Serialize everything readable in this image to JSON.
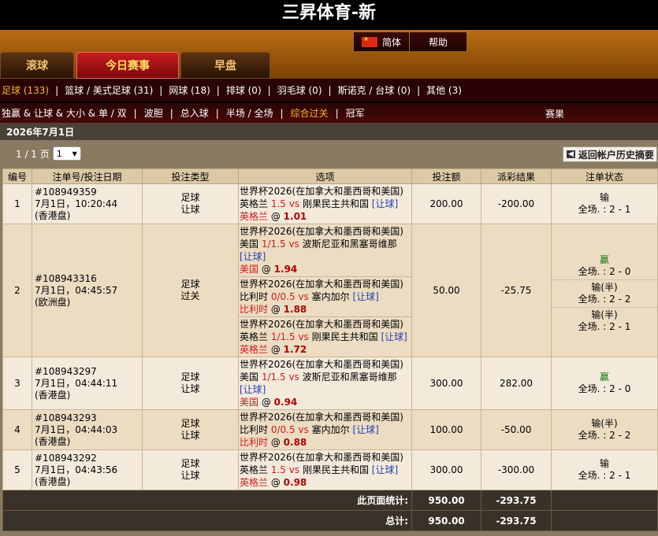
{
  "site": {
    "title": "三昇体育-新"
  },
  "util": {
    "lang": "简体",
    "help": "帮助"
  },
  "tabs": [
    "滚球",
    "今日赛事",
    "早盘"
  ],
  "sports": [
    {
      "label": "足球 (133)"
    },
    {
      "label": "篮球 / 美式足球 (31)"
    },
    {
      "label": "网球 (18)"
    },
    {
      "label": "排球 (0)"
    },
    {
      "label": "羽毛球 (0)"
    },
    {
      "label": "斯诺克 / 台球 (0)"
    },
    {
      "label": "其他 (3)"
    }
  ],
  "bettypes": [
    "独赢 & 让球 & 大小 & 单 / 双",
    "波胆",
    "总入球",
    "半场 / 全场",
    "综合过关",
    "冠军"
  ],
  "result_label": "赛果",
  "date": "2026年7月1日",
  "pager": {
    "text": "1 / 1 页",
    "selected": "1"
  },
  "back_button": "返回帐户历史摘要",
  "columns": [
    "编号",
    "注单号/投注日期",
    "投注类型",
    "选项",
    "投注额",
    "派彩结果",
    "注单状态"
  ],
  "rows": [
    {
      "num": "1",
      "id": "#108949359",
      "date": "7月1日，10:20:44",
      "market": "(香港盘)",
      "type1": "足球",
      "type2": "让球",
      "legs": [
        {
          "league": "世界杯2026(在加拿大和墨西哥和美国)",
          "home": "英格兰",
          "hd": "1.5",
          "vs": "vs",
          "away": "刚果民主共和国",
          "bt": "[让球]",
          "pick": "英格兰",
          "at": "@",
          "odds": "1.01"
        }
      ],
      "amount": "200.00",
      "winloss": "-200.00",
      "status": [
        {
          "res": "输",
          "score": "全场. : 2 - 1",
          "win": false
        }
      ]
    },
    {
      "num": "2",
      "id": "#108943316",
      "date": "7月1日，04:45:57",
      "market": "(欧洲盘)",
      "type1": "足球",
      "type2": "过关",
      "legs": [
        {
          "league": "世界杯2026(在加拿大和墨西哥和美国)",
          "home": "美国",
          "hd": "1/1.5",
          "vs": "vs",
          "away": "波斯尼亚和黑塞哥维那",
          "bt": "[让球]",
          "pick": "美国",
          "at": "@",
          "odds": "1.94"
        },
        {
          "league": "世界杯2026(在加拿大和墨西哥和美国)",
          "home": "比利时",
          "hd": "0/0.5",
          "vs": "vs",
          "away": "塞内加尔",
          "bt": "[让球]",
          "pick": "比利时",
          "at": "@",
          "odds": "1.88"
        },
        {
          "league": "世界杯2026(在加拿大和墨西哥和美国)",
          "home": "英格兰",
          "hd": "1/1.5",
          "vs": "vs",
          "away": "刚果民主共和国",
          "bt": "[让球]",
          "pick": "英格兰",
          "at": "@",
          "odds": "1.72"
        }
      ],
      "amount": "50.00",
      "winloss": "-25.75",
      "status": [
        {
          "res": "赢",
          "score": "全场. : 2 - 0",
          "win": true
        },
        {
          "res": "输(半)",
          "score": "全场. : 2 - 2",
          "win": false
        },
        {
          "res": "输(半)",
          "score": "全场. : 2 - 1",
          "win": false
        }
      ]
    },
    {
      "num": "3",
      "id": "#108943297",
      "date": "7月1日，04:44:11",
      "market": "(香港盘)",
      "type1": "足球",
      "type2": "让球",
      "legs": [
        {
          "league": "世界杯2026(在加拿大和墨西哥和美国)",
          "home": "美国",
          "hd": "1/1.5",
          "vs": "vs",
          "away": "波斯尼亚和黑塞哥维那",
          "bt": "[让球]",
          "pick": "美国",
          "at": "@",
          "odds": "0.94"
        }
      ],
      "amount": "300.00",
      "winloss": "282.00",
      "status": [
        {
          "res": "赢",
          "score": "全场. : 2 - 0",
          "win": true
        }
      ]
    },
    {
      "num": "4",
      "id": "#108943293",
      "date": "7月1日，04:44:03",
      "market": "(香港盘)",
      "type1": "足球",
      "type2": "让球",
      "legs": [
        {
          "league": "世界杯2026(在加拿大和墨西哥和美国)",
          "home": "比利时",
          "hd": "0/0.5",
          "vs": "vs",
          "away": "塞内加尔",
          "bt": "[让球]",
          "pick": "比利时",
          "at": "@",
          "odds": "0.88"
        }
      ],
      "amount": "100.00",
      "winloss": "-50.00",
      "status": [
        {
          "res": "输(半)",
          "score": "全场. : 2 - 2",
          "win": false
        }
      ]
    },
    {
      "num": "5",
      "id": "#108943292",
      "date": "7月1日，04:43:56",
      "market": "(香港盘)",
      "type1": "足球",
      "type2": "让球",
      "legs": [
        {
          "league": "世界杯2026(在加拿大和墨西哥和美国)",
          "home": "英格兰",
          "hd": "1.5",
          "vs": "vs",
          "away": "刚果民主共和国",
          "bt": "[让球]",
          "pick": "英格兰",
          "at": "@",
          "odds": "0.98"
        }
      ],
      "amount": "300.00",
      "winloss": "-300.00",
      "status": [
        {
          "res": "输",
          "score": "全场. : 2 - 1",
          "win": false
        }
      ]
    }
  ],
  "totals": [
    {
      "label": "此页面统计:",
      "amount": "950.00",
      "winloss": "-293.75"
    },
    {
      "label": "总计:",
      "amount": "950.00",
      "winloss": "-293.75"
    }
  ]
}
